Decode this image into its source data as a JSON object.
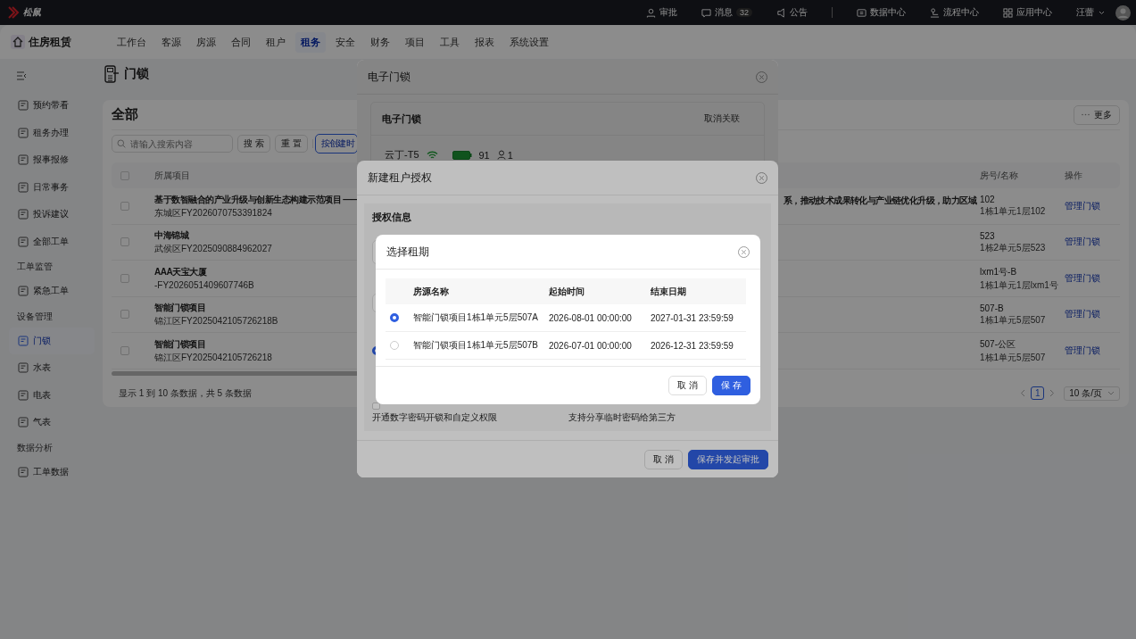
{
  "top_bar": {
    "logo": "松鼠",
    "links": [
      {
        "label": "审批"
      },
      {
        "label": "消息",
        "badge": "32"
      },
      {
        "label": "公告"
      },
      {
        "label": "数据中心"
      },
      {
        "label": "流程中心"
      },
      {
        "label": "应用中心"
      }
    ],
    "user": "汪蕾"
  },
  "nav": {
    "app_name": "住房租赁",
    "items": [
      {
        "label": "工作台",
        "selected": false
      },
      {
        "label": "客源",
        "selected": false
      },
      {
        "label": "房源",
        "selected": false
      },
      {
        "label": "合同",
        "selected": false
      },
      {
        "label": "租户",
        "selected": false
      },
      {
        "label": "租务",
        "selected": true
      },
      {
        "label": "安全",
        "selected": false
      },
      {
        "label": "财务",
        "selected": false
      },
      {
        "label": "项目",
        "selected": false
      },
      {
        "label": "工具",
        "selected": false
      },
      {
        "label": "报表",
        "selected": false
      },
      {
        "label": "系统设置",
        "selected": false
      }
    ]
  },
  "sidebar": {
    "items": [
      {
        "kind": "item",
        "label": "预约带看",
        "selected": false
      },
      {
        "kind": "item",
        "label": "租务办理",
        "selected": false
      },
      {
        "kind": "item",
        "label": "报事报修",
        "selected": false
      },
      {
        "kind": "item",
        "label": "日常事务",
        "selected": false
      },
      {
        "kind": "item",
        "label": "投诉建议",
        "selected": false
      },
      {
        "kind": "item",
        "label": "全部工单",
        "selected": false
      },
      {
        "kind": "group",
        "label": "工单监管"
      },
      {
        "kind": "item",
        "label": "紧急工单",
        "selected": false
      },
      {
        "kind": "group",
        "label": "设备管理"
      },
      {
        "kind": "item",
        "label": "门锁",
        "selected": true
      },
      {
        "kind": "item",
        "label": "水表",
        "selected": false
      },
      {
        "kind": "item",
        "label": "电表",
        "selected": false
      },
      {
        "kind": "item",
        "label": "气表",
        "selected": false
      },
      {
        "kind": "group",
        "label": "数据分析"
      },
      {
        "kind": "item",
        "label": "工单数据",
        "selected": false
      }
    ]
  },
  "page": {
    "title": "门锁",
    "card_title": "全部",
    "more": "更多",
    "search_placeholder": "请输入搜索内容",
    "buttons": [
      "搜 索",
      "重 置"
    ],
    "sort_button": "按创建时"
  },
  "table": {
    "header_checked": false,
    "columns": [
      "所属项目",
      "房号/名称",
      "操作"
    ],
    "rows": [
      {
        "checked": false,
        "project": "基于数智融合的产业升级与创新生态构建示范项目 ——",
        "code": "东城区FY2026070753391824",
        "column_3": "系，推动技术成果转化与产业链优化升级，助力区域",
        "room": "102",
        "room_detail": "1栋1单元1层102",
        "action": "管理门锁"
      },
      {
        "checked": false,
        "project": "中海锦城",
        "code": "武侯区FY2025090884962027",
        "room": "523",
        "room_detail": "1栋2单元5层523",
        "action": "管理门锁"
      },
      {
        "checked": false,
        "project": "AAA天宝大厦",
        "code": "-FY2026051409607746B",
        "room": "lxm1号-B",
        "room_detail": "1栋1单元1层lxm1号",
        "action": "管理门锁"
      },
      {
        "checked": false,
        "project": "智能门锁项目",
        "code": "锦江区FY2025042105726218B",
        "room": "507-B",
        "room_detail": "1栋1单元5层507",
        "action": "管理门锁"
      },
      {
        "checked": false,
        "project": "智能门锁项目",
        "code": "锦江区FY2025042105726218",
        "room": "507-公区",
        "room_detail": "1栋1单元5层507",
        "action": "管理门锁"
      }
    ]
  },
  "footer": {
    "summary": "显示 1 到 10 条数据，共 5 条数据",
    "page": "1",
    "page_size": "10 条/页"
  },
  "lock_dialog": {
    "title": "电子门锁",
    "card_title": "电子门锁",
    "unlink": "取消关联",
    "device": "云丁-T5",
    "battery": "91",
    "users": "1"
  },
  "auth_dialog": {
    "title": "新建租户授权",
    "section": "授权信息",
    "radio": {
      "selected": true
    },
    "checkbox": {
      "checked": false
    },
    "option_texts": [
      "开通数字密码开锁和自定义权限",
      "支持分享临时密码给第三方"
    ],
    "buttons": [
      "取 消",
      "保存并发起审批"
    ]
  },
  "term_dialog": {
    "title": "选择租期",
    "columns": [
      "房源名称",
      "起始时间",
      "结束日期"
    ],
    "rows": [
      {
        "selected": true,
        "name": "智能门锁项目1栋1单元5层507A",
        "start": "2026-08-01 00:00:00",
        "end": "2027-01-31 23:59:59"
      },
      {
        "selected": false,
        "name": "智能门锁项目1栋1单元5层507B",
        "start": "2026-07-01 00:00:00",
        "end": "2026-12-31 23:59:59"
      }
    ],
    "buttons": [
      "取 消",
      "保 存"
    ]
  }
}
